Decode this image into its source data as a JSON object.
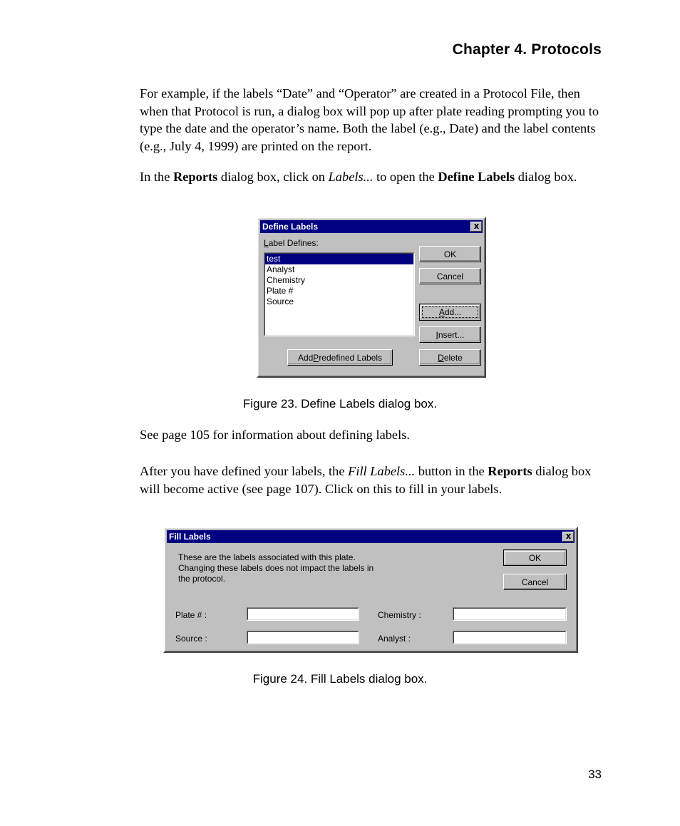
{
  "page": {
    "header": "Chapter 4.  Protocols",
    "number": "33"
  },
  "paragraphs": {
    "intro": "For example, if the labels “Date” and “Operator” are created in a Protocol File, then when that Protocol is run, a dialog box will pop up after plate reading prompting you to type the date and the operator’s name. Both the label (e.g., Date) and the label contents (e.g., July 4, 1999) are printed on the report.",
    "reports_lead": "In the ",
    "reports_bold1": "Reports",
    "reports_mid1": " dialog box, click on ",
    "reports_italic": "Labels...",
    "reports_mid2": " to open the ",
    "reports_bold2": "Define Labels",
    "reports_tail": " dialog box.",
    "see_page": "See page 105 for information about defining labels.",
    "fill_lead": "After you have defined your labels, the ",
    "fill_italic": "Fill Labels...",
    "fill_mid": " button in the ",
    "fill_bold": "Reports",
    "fill_tail": " dialog box will become active (see page 107). Click on this to fill in your labels."
  },
  "captions": {
    "figure_23": "Figure 23.  Define Labels dialog box.",
    "figure_24": "Figure 24.  Fill Labels dialog box."
  },
  "define_labels_dialog": {
    "title": "Define Labels",
    "close_icon": "close-icon",
    "list_label_pre": "L",
    "list_label_post": "abel Defines:",
    "items": [
      {
        "text": "test",
        "selected": true
      },
      {
        "text": "Analyst",
        "selected": false
      },
      {
        "text": "Chemistry",
        "selected": false
      },
      {
        "text": "Plate #",
        "selected": false
      },
      {
        "text": "Source",
        "selected": false
      }
    ],
    "buttons": {
      "ok": "OK",
      "cancel": "Cancel",
      "add_pre": "A",
      "add_post": "dd...",
      "insert_pre": "I",
      "insert_post": "nsert...",
      "delete_pre": "D",
      "delete_post": "elete",
      "add_predefined_pre": "Add ",
      "add_predefined_acc": "P",
      "add_predefined_post": "redefined Labels"
    }
  },
  "fill_labels_dialog": {
    "title": "Fill Labels",
    "close_icon": "close-icon",
    "description": "These are the labels associated with this plate.\nChanging these labels does not impact the labels in\nthe protocol.",
    "buttons": {
      "ok": "OK",
      "cancel": "Cancel"
    },
    "fields": [
      {
        "label": "Plate # :",
        "value": ""
      },
      {
        "label": "Source :",
        "value": ""
      },
      {
        "label": "Chemistry :",
        "value": ""
      },
      {
        "label": "Analyst :",
        "value": ""
      }
    ]
  },
  "colors": {
    "titlebar": "#000080",
    "dialog_face": "#c0c0c0",
    "selection": "#000080"
  }
}
